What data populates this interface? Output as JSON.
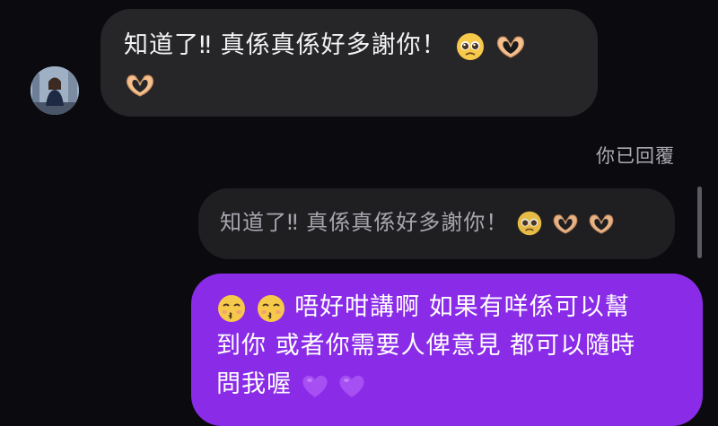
{
  "conversation": {
    "incoming": {
      "text": "知道了‼ 真係真係好多謝你！",
      "emojis": [
        "pleading-face-icon",
        "heart-hands-icon",
        "heart-hands-icon"
      ]
    },
    "reply_label": "你已回覆",
    "quoted": {
      "text": "知道了‼ 真係真係好多謝你！",
      "emojis": [
        "pleading-face-icon",
        "heart-hands-icon",
        "heart-hands-icon"
      ]
    },
    "outgoing": {
      "line1": "唔好咁講啊 如果有咩係可以幫",
      "line2": "到你 或者你需要人俾意見 都可以隨時",
      "line3": "問我喔",
      "emojis": [
        "kissing-face-icon",
        "kissing-face-icon",
        "purple-heart-icon",
        "purple-heart-icon"
      ]
    }
  },
  "colors": {
    "background": "#0b0b0f",
    "incoming_bubble": "#262629",
    "quoted_bubble": "#1f1f22",
    "outgoing_bubble": "#8a2be8",
    "purple_heart": "#a64ff2"
  }
}
